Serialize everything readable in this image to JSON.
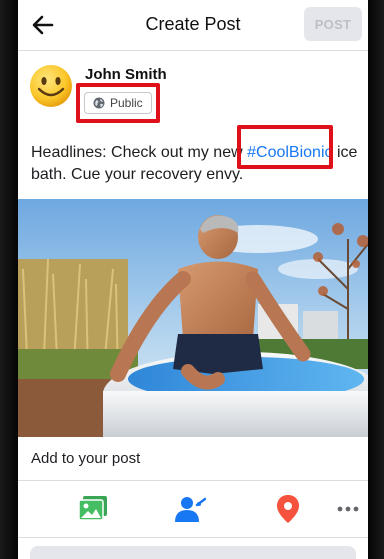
{
  "header": {
    "title": "Create Post",
    "back_icon": "arrow-left-icon",
    "post_label": "POST"
  },
  "author": {
    "name": "John Smith",
    "avatar_icon": "smiley-face-icon",
    "privacy_icon": "globe-icon",
    "privacy_label": "Public"
  },
  "post": {
    "text_before": "Headlines: Check out my new ",
    "hashtag": "#CoolBionic",
    "text_after": " ice bath. Cue your recovery envy."
  },
  "composer": {
    "add_label": "Add to your post",
    "actions": [
      {
        "icon": "photo-icon",
        "color": "#45bd62"
      },
      {
        "icon": "tag-people-icon",
        "color": "#1877f2"
      },
      {
        "icon": "location-pin-icon",
        "color": "#f5533d"
      },
      {
        "icon": "more-icon",
        "color": "#65676b"
      }
    ]
  },
  "colors": {
    "highlight": "#e0101b",
    "hashtag": "#1877f2",
    "post_button_bg": "#e4e6eb"
  }
}
